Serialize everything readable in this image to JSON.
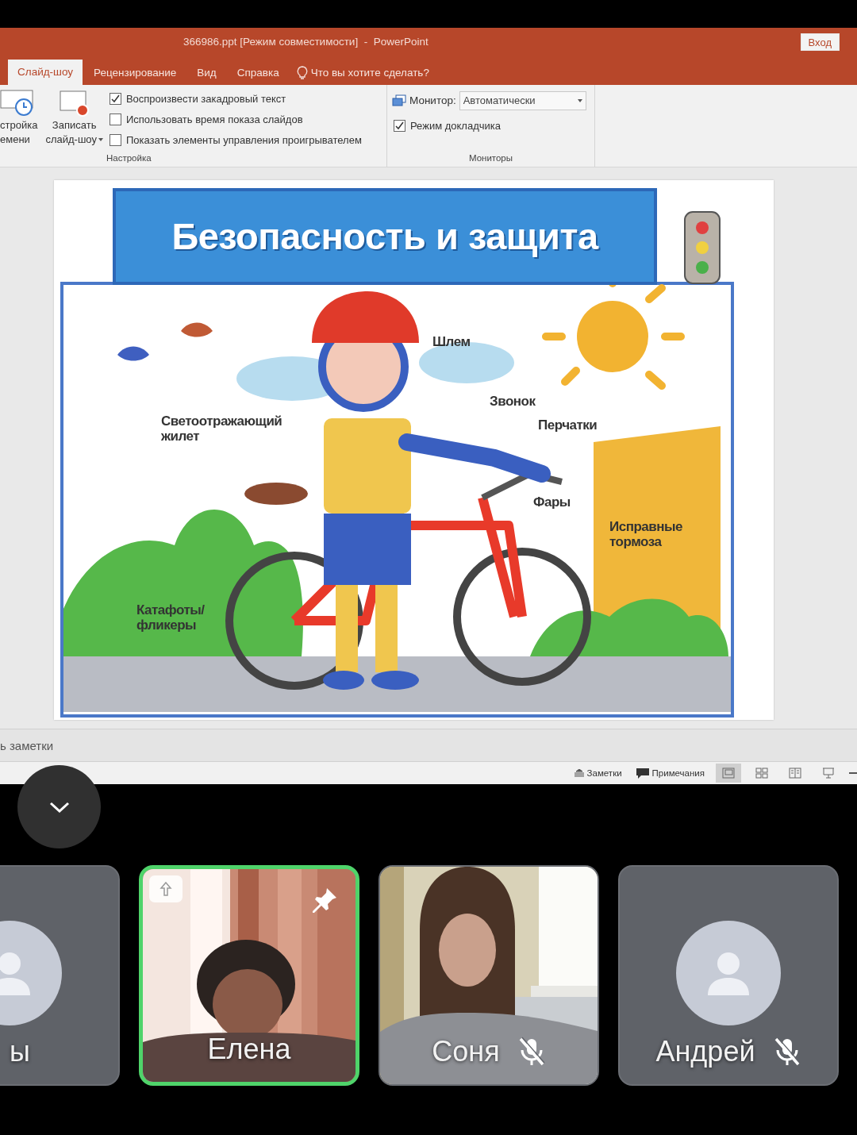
{
  "window": {
    "title": "366986.ppt [Режим совместимости]  -  PowerPoint",
    "sign_in": "Вход"
  },
  "tabs": [
    {
      "label": "Слайд-шоу",
      "selected": true
    },
    {
      "label": "Рецензирование",
      "selected": false
    },
    {
      "label": "Вид",
      "selected": false
    },
    {
      "label": "Справка",
      "selected": false
    }
  ],
  "tell_me": "Что вы хотите сделать?",
  "ribbon": {
    "buttons": [
      {
        "kind": "timer",
        "lines": [
          "стройка",
          "емени"
        ]
      },
      {
        "kind": "record",
        "lines": [
          "Записать",
          "слайд-шоу"
        ]
      }
    ],
    "options": [
      {
        "label": "Воспроизвести закадровый текст",
        "checked": true
      },
      {
        "label": "Использовать время показа слайдов",
        "checked": false
      },
      {
        "label": "Показать элементы управления проигрывателем",
        "checked": false
      }
    ],
    "setup_group": "Настройка",
    "monitor_label": "Монитор:",
    "monitor_value": "Автоматически",
    "presenter": {
      "label": "Режим докладчика",
      "checked": true
    },
    "monitors_group": "Мониторы"
  },
  "slide": {
    "title": "Безопасность и защита",
    "labels": [
      "Шлем",
      "Звонок",
      "Перчатки",
      "Светоотражающий жилет",
      "Фары",
      "Исправные тормоза",
      "Катафоты/ фликеры"
    ]
  },
  "notes_placeholder": "ь заметки",
  "status_bar": {
    "notes": "Заметки",
    "comments": "Примечания",
    "views": [
      {
        "kind": "normal",
        "selected": true
      },
      {
        "kind": "sorter",
        "selected": false
      },
      {
        "kind": "reading",
        "selected": false
      },
      {
        "kind": "show",
        "selected": false
      }
    ]
  },
  "participants": [
    {
      "name": "ы",
      "kind": "avatar",
      "selected": false
    },
    {
      "name": "Елена",
      "kind": "video",
      "selected": true,
      "pinned": true,
      "raised": true,
      "muted": false
    },
    {
      "name": "Соня",
      "kind": "video",
      "selected": false,
      "pinned": false,
      "raised": false,
      "muted": true
    },
    {
      "name": "Андрей",
      "kind": "avatar",
      "selected": false,
      "pinned": false,
      "raised": false,
      "muted": true
    }
  ]
}
